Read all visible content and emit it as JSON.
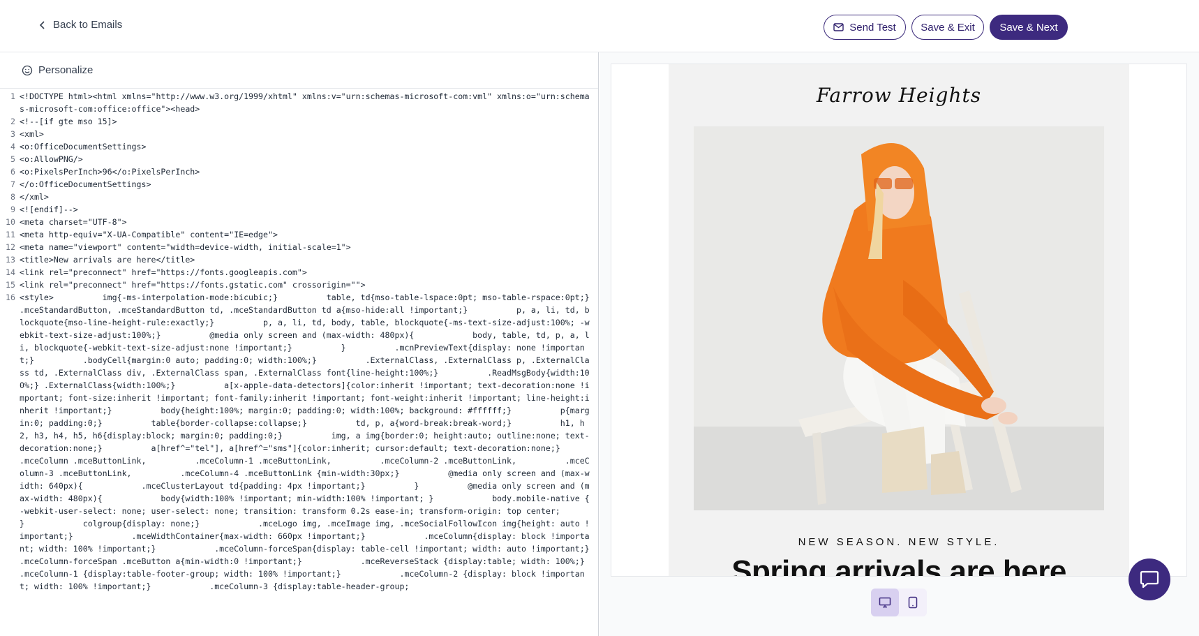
{
  "header": {
    "back_label": "Back to Emails",
    "send_test_label": "Send Test",
    "save_exit_label": "Save & Exit",
    "save_next_label": "Save & Next"
  },
  "editor": {
    "personalize_label": "Personalize",
    "lines": [
      {
        "n": "1",
        "text": "<!DOCTYPE html><html xmlns=\"http://www.w3.org/1999/xhtml\" xmlns:v=\"urn:schemas-microsoft-com:vml\" xmlns:o=\"urn:schemas-microsoft-com:office:office\"><head>"
      },
      {
        "n": "2",
        "text": "<!--[if gte mso 15]>"
      },
      {
        "n": "3",
        "text": "<xml>"
      },
      {
        "n": "4",
        "text": "<o:OfficeDocumentSettings>"
      },
      {
        "n": "5",
        "text": "<o:AllowPNG/>"
      },
      {
        "n": "6",
        "text": "<o:PixelsPerInch>96</o:PixelsPerInch>"
      },
      {
        "n": "7",
        "text": "</o:OfficeDocumentSettings>"
      },
      {
        "n": "8",
        "text": "</xml>"
      },
      {
        "n": "9",
        "text": "<![endif]-->"
      },
      {
        "n": "10",
        "text": "<meta charset=\"UTF-8\">"
      },
      {
        "n": "11",
        "text": "<meta http-equiv=\"X-UA-Compatible\" content=\"IE=edge\">"
      },
      {
        "n": "12",
        "text": "<meta name=\"viewport\" content=\"width=device-width, initial-scale=1\">"
      },
      {
        "n": "13",
        "text": "<title>New arrivals are here</title>"
      },
      {
        "n": "14",
        "text": "<link rel=\"preconnect\" href=\"https://fonts.googleapis.com\">"
      },
      {
        "n": "15",
        "text": "<link rel=\"preconnect\" href=\"https://fonts.gstatic.com\" crossorigin=\"\">"
      },
      {
        "n": "16",
        "text": "<style>          img{-ms-interpolation-mode:bicubic;}          table, td{mso-table-lspace:0pt; mso-table-rspace:0pt;}          .mceStandardButton, .mceStandardButton td, .mceStandardButton td a{mso-hide:all !important;}          p, a, li, td, blockquote{mso-line-height-rule:exactly;}          p, a, li, td, body, table, blockquote{-ms-text-size-adjust:100%; -webkit-text-size-adjust:100%;}          @media only screen and (max-width: 480px){            body, table, td, p, a, li, blockquote{-webkit-text-size-adjust:none !important;}          }          .mcnPreviewText{display: none !important;}          .bodyCell{margin:0 auto; padding:0; width:100%;}          .ExternalClass, .ExternalClass p, .ExternalClass td, .ExternalClass div, .ExternalClass span, .ExternalClass font{line-height:100%;}          .ReadMsgBody{width:100%;} .ExternalClass{width:100%;}          a[x-apple-data-detectors]{color:inherit !important; text-decoration:none !important; font-size:inherit !important; font-family:inherit !important; font-weight:inherit !important; line-height:inherit !important;}          body{height:100%; margin:0; padding:0; width:100%; background: #ffffff;}          p{margin:0; padding:0;}          table{border-collapse:collapse;}          td, p, a{word-break:break-word;}          h1, h2, h3, h4, h5, h6{display:block; margin:0; padding:0;}          img, a img{border:0; height:auto; outline:none; text-decoration:none;}          a[href^=\"tel\"], a[href^=\"sms\"]{color:inherit; cursor:default; text-decoration:none;}          .mceColumn .mceButtonLink,          .mceColumn-1 .mceButtonLink,          .mceColumn-2 .mceButtonLink,          .mceColumn-3 .mceButtonLink,          .mceColumn-4 .mceButtonLink {min-width:30px;}          @media only screen and (max-width: 640px){            .mceClusterLayout td{padding: 4px !important;}          }          @media only screen and (max-width: 480px){            body{width:100% !important; min-width:100% !important; }            body.mobile-native {              -webkit-user-select: none; user-select: none; transition: transform 0.2s ease-in; transform-origin: top center;            }            colgroup{display: none;}            .mceLogo img, .mceImage img, .mceSocialFollowIcon img{height: auto !important;}            .mceWidthContainer{max-width: 660px !important;}            .mceColumn{display: block !important; width: 100% !important;}            .mceColumn-forceSpan{display: table-cell !important; width: auto !important;}            .mceColumn-forceSpan .mceButton a{min-width:0 !important;}            .mceReverseStack {display:table; width: 100%;}            .mceColumn-1 {display:table-footer-group; width: 100% !important;}            .mceColumn-2 {display: block !important; width: 100% !important;}            .mceColumn-3 {display:table-header-group;"
      }
    ]
  },
  "preview": {
    "logo_text": "Farrow Heights",
    "eyebrow": "NEW SEASON. NEW STYLE.",
    "headline": "Spring arrivals are here",
    "hero_icon": "model-photo",
    "device_options": [
      "desktop-icon",
      "mobile-icon"
    ]
  },
  "colors": {
    "brand": "#3d2a7f",
    "hoodie": "#f07a1e"
  }
}
